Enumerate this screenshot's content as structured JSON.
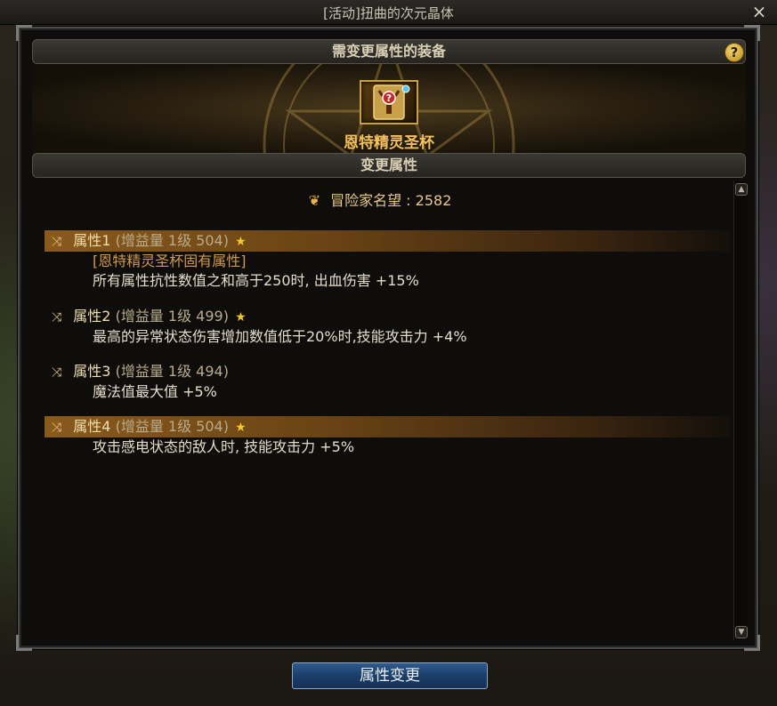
{
  "window": {
    "title": "[活动]扭曲的次元晶体",
    "close_label": "×"
  },
  "equip_section": {
    "header": "需变更属性的装备",
    "help_label": "?",
    "item_name": "恩特精灵圣杯"
  },
  "change_section": {
    "header": "变更属性",
    "fame_label": "冒险家名望 : 2582"
  },
  "attributes": [
    {
      "name": "属性1",
      "detail": "(增益量 1级 504)",
      "star": "★",
      "highlighted": true,
      "lines": [
        {
          "text": "[恩特精灵圣杯固有属性]",
          "color": "orange"
        },
        {
          "text": "所有属性抗性数值之和高于250时, 出血伤害 +15%",
          "color": "white"
        }
      ]
    },
    {
      "name": "属性2",
      "detail": "(增益量 1级 499)",
      "star": "★",
      "highlighted": false,
      "lines": [
        {
          "text": "最高的异常状态伤害增加数值低于20%时,技能攻击力 +4%",
          "color": "white"
        }
      ]
    },
    {
      "name": "属性3",
      "detail": "(增益量 1级 494)",
      "star": "",
      "highlighted": false,
      "lines": [
        {
          "text": "魔法值最大值 +5%",
          "color": "white"
        }
      ]
    },
    {
      "name": "属性4",
      "detail": "(增益量 1级 504)",
      "star": "★",
      "highlighted": true,
      "lines": [
        {
          "text": "攻击感电状态的敌人时, 技能攻击力 +5%",
          "color": "white"
        }
      ]
    }
  ],
  "bottom_button": {
    "label": "属性变更"
  },
  "colors": {
    "accent_gold": "#f2c15c",
    "highlight_row": "#8a5a1c",
    "button_blue": "#2f5a8e"
  },
  "icons": {
    "shuffle": "shuffle-icon",
    "fame": "fame-emblem-icon",
    "help": "help-icon",
    "close": "close-icon"
  }
}
